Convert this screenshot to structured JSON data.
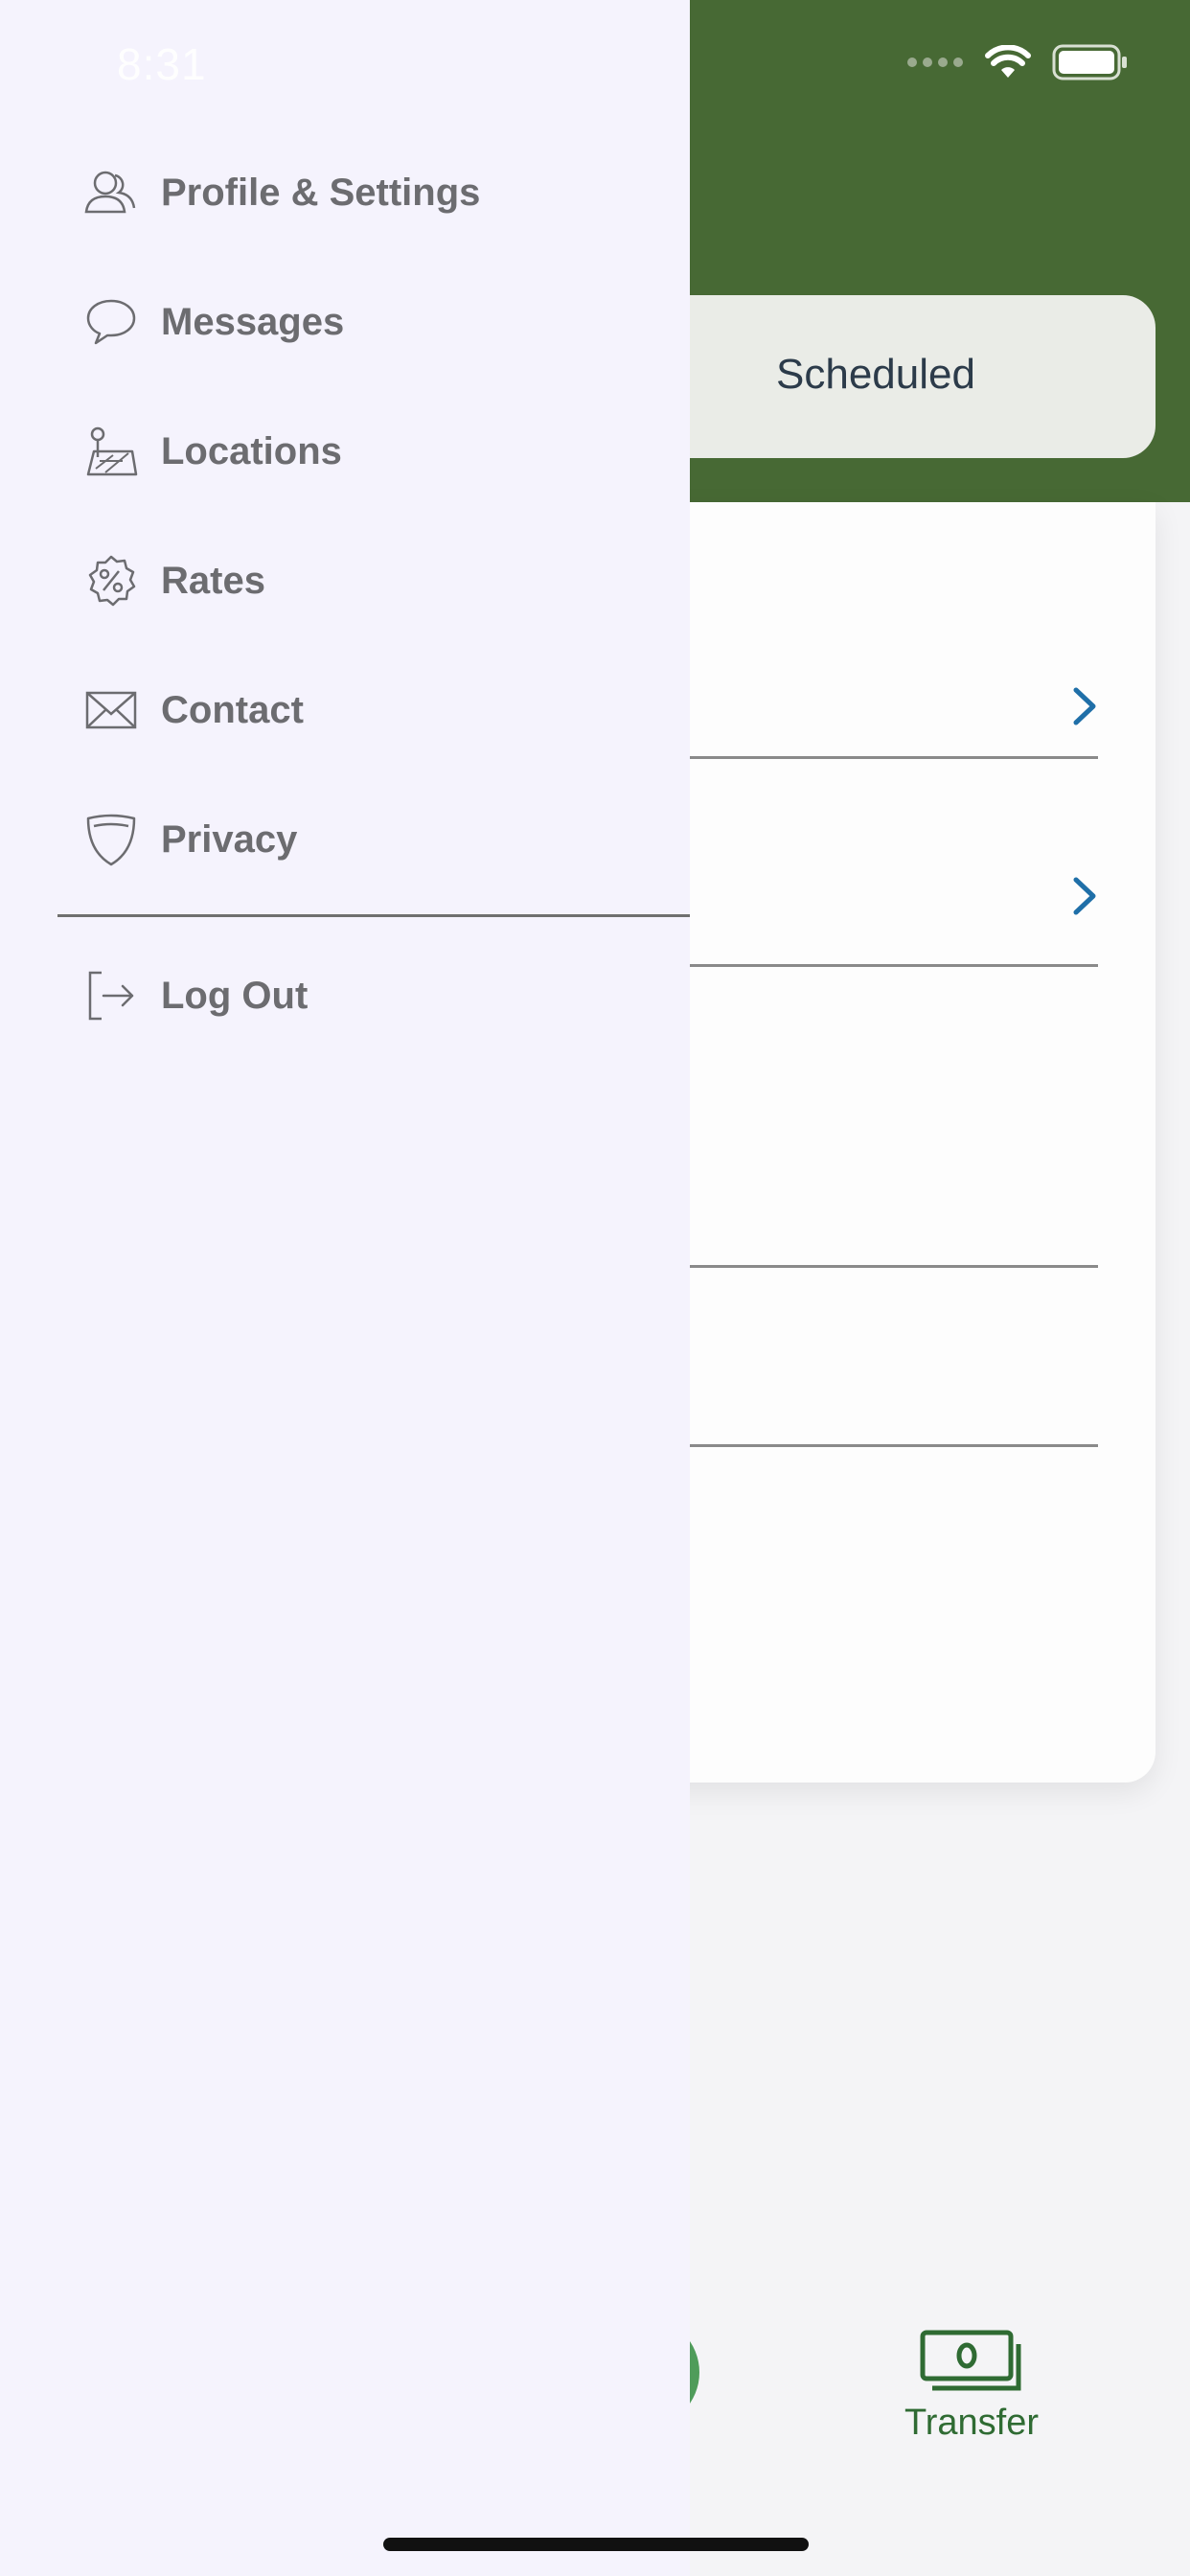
{
  "status_bar": {
    "time": "8:31"
  },
  "app": {
    "segment_label": "Scheduled",
    "bottom_tab": {
      "label": "Transfer",
      "icon": "money-icon"
    },
    "colors": {
      "header": "#476934",
      "accent": "#2f6b33",
      "chevron": "#1f6fa8"
    }
  },
  "drawer": {
    "items": [
      {
        "label": "Profile & Settings",
        "icon": "profile-icon"
      },
      {
        "label": "Messages",
        "icon": "messages-icon"
      },
      {
        "label": "Locations",
        "icon": "locations-icon"
      },
      {
        "label": "Rates",
        "icon": "rates-icon"
      },
      {
        "label": "Contact",
        "icon": "mail-icon"
      },
      {
        "label": "Privacy",
        "icon": "shield-icon"
      }
    ],
    "logout": {
      "label": "Log Out",
      "icon": "logout-icon"
    }
  }
}
